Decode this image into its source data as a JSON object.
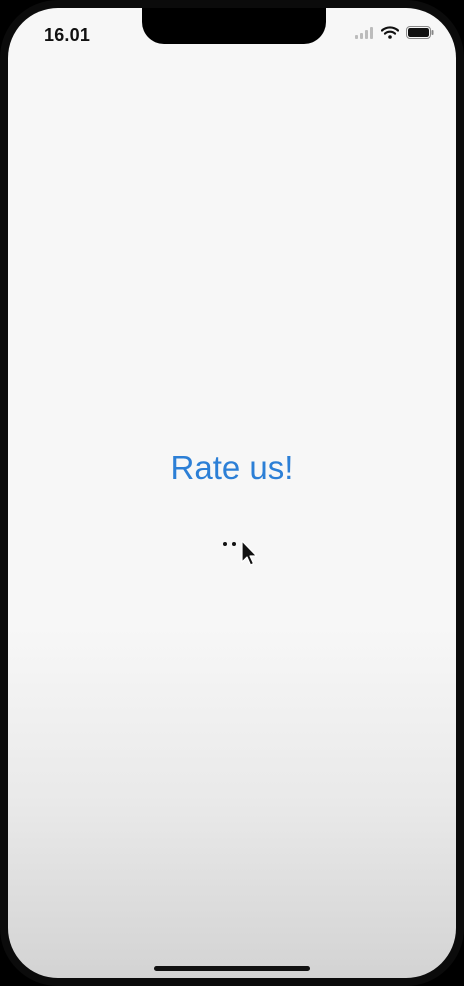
{
  "status_bar": {
    "time": "16.01",
    "icons": [
      "cellular-signal-icon",
      "wifi-icon",
      "battery-icon"
    ]
  },
  "main": {
    "rate_button_label": "Rate us!",
    "accent_color": "#2c7fd6",
    "loading_indicator": "activity-dots-icon"
  },
  "cursor": "mouse-pointer-icon"
}
